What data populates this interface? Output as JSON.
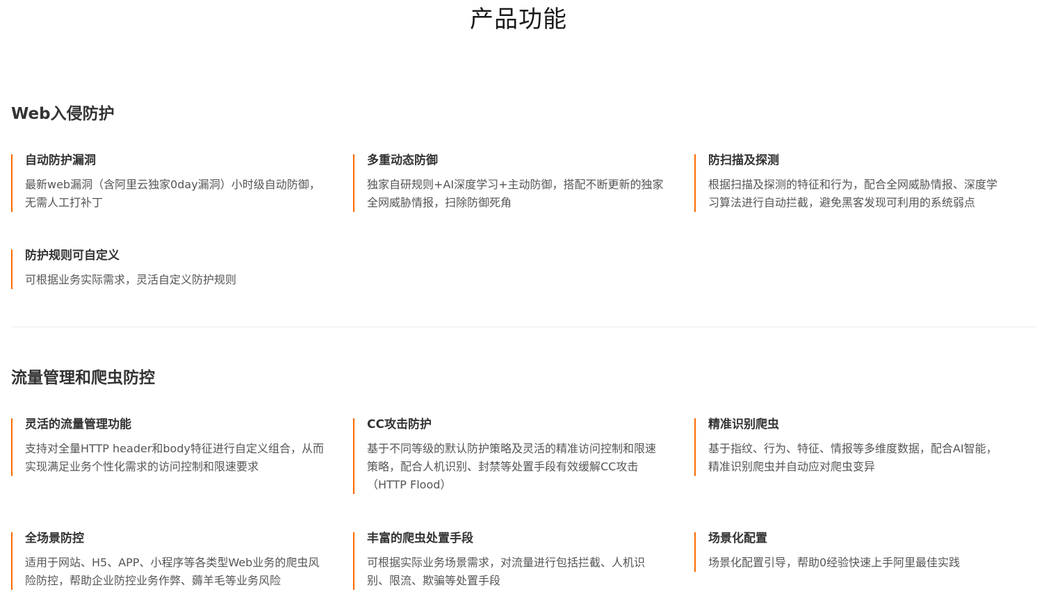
{
  "page": {
    "title": "产品功能"
  },
  "colors": {
    "accent": "#ff6a00",
    "text": "#333333",
    "divider": "#ececec"
  },
  "sections": [
    {
      "title": "Web入侵防护",
      "features": [
        {
          "title": "自动防护漏洞",
          "desc": "最新web漏洞（含阿里云独家0day漏洞）小时级自动防御，无需人工打补丁"
        },
        {
          "title": "多重动态防御",
          "desc": "独家自研规则+AI深度学习+主动防御，搭配不断更新的独家全网威胁情报，扫除防御死角"
        },
        {
          "title": "防扫描及探测",
          "desc": "根据扫描及探测的特征和行为，配合全网威胁情报、深度学习算法进行自动拦截，避免黑客发现可利用的系统弱点"
        },
        {
          "title": "防护规则可自定义",
          "desc": "可根据业务实际需求，灵活自定义防护规则"
        }
      ]
    },
    {
      "title": "流量管理和爬虫防控",
      "features": [
        {
          "title": "灵活的流量管理功能",
          "desc": "支持对全量HTTP header和body特征进行自定义组合，从而实现满足业务个性化需求的访问控制和限速要求"
        },
        {
          "title": "CC攻击防护",
          "desc": "基于不同等级的默认防护策略及灵活的精准访问控制和限速策略，配合人机识别、封禁等处置手段有效缓解CC攻击（HTTP Flood）"
        },
        {
          "title": "精准识别爬虫",
          "desc": "基于指纹、行为、特征、情报等多维度数据，配合AI智能，精准识别爬虫并自动应对爬虫变异"
        },
        {
          "title": "全场景防控",
          "desc": "适用于网站、H5、APP、小程序等各类型Web业务的爬虫风险防控，帮助企业防控业务作弊、薅羊毛等业务风险"
        },
        {
          "title": "丰富的爬虫处置手段",
          "desc": "可根据实际业务场景需求，对流量进行包括拦截、人机识别、限流、欺骗等处置手段"
        },
        {
          "title": "场景化配置",
          "desc": "场景化配置引导，帮助0经验快速上手阿里最佳实践"
        }
      ]
    }
  ]
}
